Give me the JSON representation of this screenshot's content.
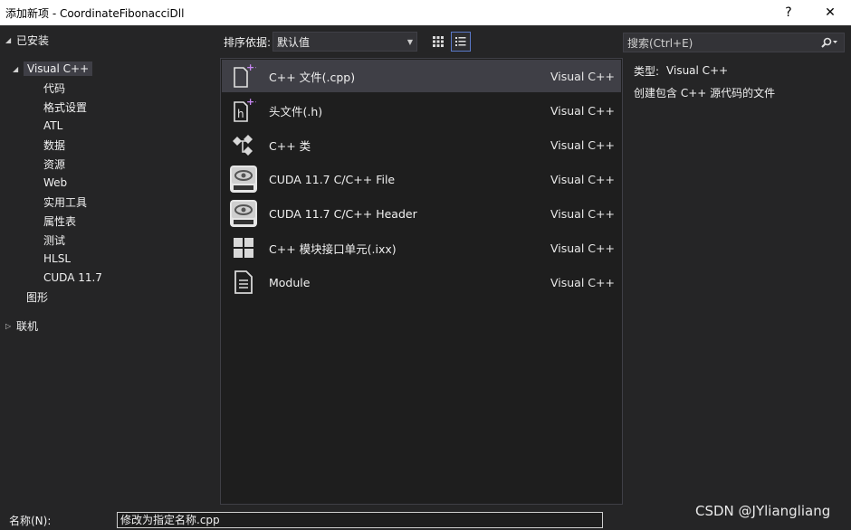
{
  "window": {
    "title": "添加新项 - CoordinateFibonacciDll",
    "help_label": "?",
    "close_label": "✕"
  },
  "tree": {
    "installed": "已安装",
    "visual_cpp": "Visual C++",
    "children": [
      "代码",
      "格式设置",
      "ATL",
      "数据",
      "资源",
      "Web",
      "实用工具",
      "属性表",
      "测试",
      "HLSL",
      "CUDA 11.7"
    ],
    "graphics": "图形",
    "online": "联机"
  },
  "toolbar": {
    "sort_label": "排序依据:",
    "sort_value": "默认值"
  },
  "items": [
    {
      "name": "C++ 文件(.cpp)",
      "lang": "Visual C++",
      "icon": "cpp-file-icon"
    },
    {
      "name": "头文件(.h)",
      "lang": "Visual C++",
      "icon": "header-file-icon"
    },
    {
      "name": "C++ 类",
      "lang": "Visual C++",
      "icon": "class-icon"
    },
    {
      "name": "CUDA 11.7 C/C++ File",
      "lang": "Visual C++",
      "icon": "nvidia-icon"
    },
    {
      "name": "CUDA 11.7 C/C++ Header",
      "lang": "Visual C++",
      "icon": "nvidia-icon"
    },
    {
      "name": "C++ 模块接口单元(.ixx)",
      "lang": "Visual C++",
      "icon": "module-interface-icon"
    },
    {
      "name": "Module",
      "lang": "Visual C++",
      "icon": "module-file-icon"
    }
  ],
  "search": {
    "placeholder": "搜索(Ctrl+E)"
  },
  "detail": {
    "type_key": "类型:",
    "type_value": "Visual C++",
    "description": "创建包含 C++ 源代码的文件"
  },
  "bottom": {
    "name_label": "名称(N):",
    "name_value": "修改为指定名称.cpp"
  },
  "watermark": "CSDN @JYliangliang"
}
